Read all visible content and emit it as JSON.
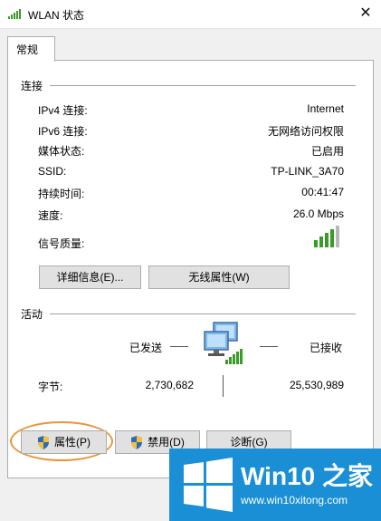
{
  "window": {
    "title": "WLAN 状态",
    "close_glyph": "✕"
  },
  "tabs": [
    {
      "label": "常规"
    }
  ],
  "connection": {
    "section_label": "连接",
    "rows": [
      {
        "label": "IPv4 连接:",
        "value": "Internet"
      },
      {
        "label": "IPv6 连接:",
        "value": "无网络访问权限"
      },
      {
        "label": "媒体状态:",
        "value": "已启用"
      },
      {
        "label": "SSID:",
        "value": "TP-LINK_3A70"
      },
      {
        "label": "持续时间:",
        "value": "00:41:47"
      },
      {
        "label": "速度:",
        "value": "26.0 Mbps"
      }
    ],
    "signal_label": "信号质量:",
    "signal_icon": "signal-bars-icon",
    "signal_strength": 4,
    "details_button": "详细信息(E)...",
    "wireless_props_button": "无线属性(W)"
  },
  "activity": {
    "section_label": "活动",
    "sent_label": "已发送",
    "received_label": "已接收",
    "bytes_label": "字节:",
    "bytes_sent": "2,730,682",
    "bytes_received": "25,530,989",
    "icon": "network-computers-icon"
  },
  "buttons": {
    "properties": "属性(P)",
    "disable": "禁用(D)",
    "diagnose": "诊断(G)"
  },
  "watermark": {
    "brand": "Win10 之家",
    "url": "www.win10xitong.com"
  },
  "colors": {
    "highlight_circle": "#e8963a",
    "signal_green": "#3a9a2a",
    "logo_blue": "#1a8fd6"
  }
}
